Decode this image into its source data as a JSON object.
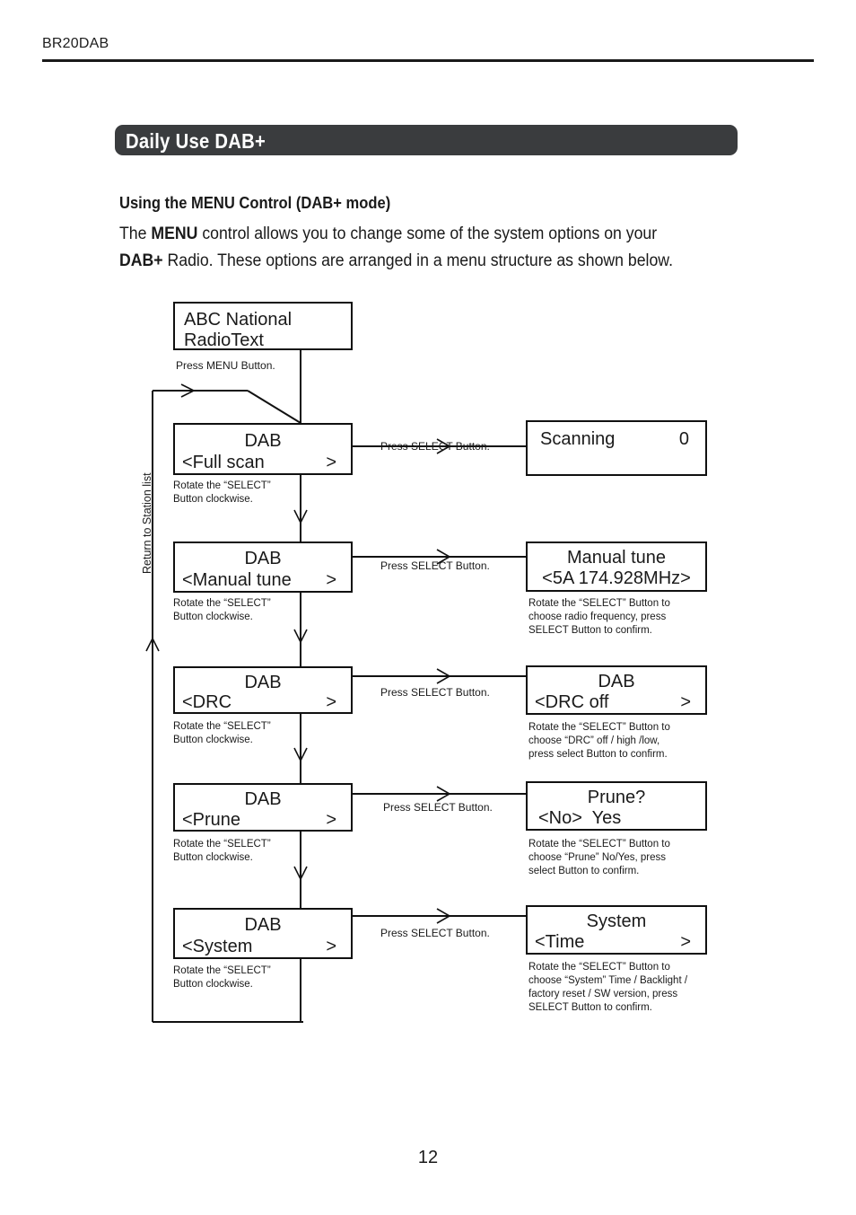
{
  "header": {
    "model": "BR20DAB"
  },
  "banner": {
    "title": "Daily Use DAB+"
  },
  "intro": {
    "subheading": "Using the MENU Control (DAB+ mode)",
    "line1_a": "The ",
    "line1_b": "MENU",
    "line1_c": " control allows you to change some of the system options on your ",
    "line1_d": "DAB+",
    "line2": "Radio. These options are arranged in a menu structure as shown below."
  },
  "diagram": {
    "loop_label": "Return to Station list",
    "press_menu": "Press MENU Button.",
    "press_select": "Press SELECT Button.",
    "rotate_note": "Rotate the “SELECT”\nButton clockwise.",
    "station_box": {
      "line1": "ABC National",
      "line2": "RadioText"
    },
    "rows": [
      {
        "menu": {
          "line1": "DAB",
          "left": "<Full scan",
          "right": ">"
        },
        "arrow_label": "Press SELECT Button.",
        "result": {
          "line1": "Scanning",
          "line1_right": "0",
          "line2": "",
          "right": ""
        },
        "result_note": ""
      },
      {
        "menu": {
          "line1": "DAB",
          "left": "<Manual tune",
          "right": ">"
        },
        "arrow_label": "Press SELECT Button.",
        "result": {
          "line1": "Manual tune",
          "line2": "<5A 174.928MHz>"
        },
        "result_note": "Rotate the “SELECT” Button to\nchoose radio frequency, press\nSELECT Button to confirm."
      },
      {
        "menu": {
          "line1": "DAB",
          "left": "<DRC",
          "right": ">"
        },
        "arrow_label": "Press SELECT Button.",
        "result": {
          "line1": "DAB",
          "line2": "<DRC off",
          "right": ">"
        },
        "result_note": "Rotate the “SELECT” Button to\nchoose “DRC” off / high /low,\npress select Button to confirm."
      },
      {
        "menu": {
          "line1": "DAB",
          "left": "<Prune",
          "right": ">"
        },
        "arrow_label": "Press SELECT Button.",
        "result": {
          "line1": "Prune?",
          "line2": "<No>  Yes"
        },
        "result_note": "Rotate the “SELECT” Button to\nchoose “Prune”  No/Yes, press\nselect Button to confirm."
      },
      {
        "menu": {
          "line1": "DAB",
          "left": "<System",
          "right": ">"
        },
        "arrow_label": "Press SELECT Button.",
        "result": {
          "line1": "System",
          "line2": "<Time",
          "right": ">"
        },
        "result_note": "Rotate the “SELECT” Button to\nchoose “System” Time / Backlight /\nfactory reset / SW version, press\nSELECT Button to confirm."
      }
    ]
  },
  "footer": {
    "page_number": "12"
  }
}
